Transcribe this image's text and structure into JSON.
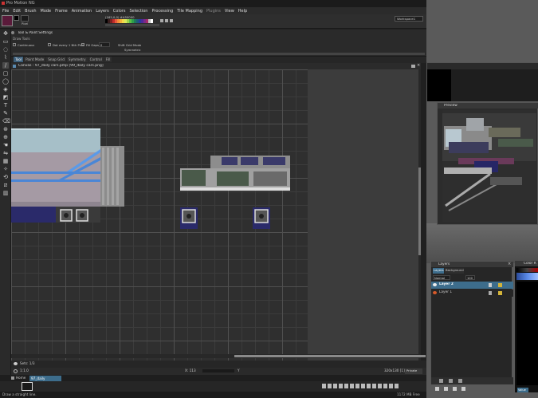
{
  "app": {
    "title": "Pro Motion NG",
    "menu": [
      "File",
      "Edit",
      "Brush",
      "Mode",
      "Frame",
      "Animation",
      "Layers",
      "Colors",
      "Selection",
      "Processing",
      "Tile Mapping",
      "Plugins",
      "View",
      "Help"
    ],
    "workspace": "Workspace1"
  },
  "toolbar": {
    "color_readout": "(165,0,0) #A50000",
    "brush_label": "Pixel",
    "brush_size": "1x1 S",
    "palette_colors": [
      "#000000",
      "#3b1f1f",
      "#7a2020",
      "#c02b2b",
      "#e85a3a",
      "#f08a3c",
      "#f4b23a",
      "#f4d648",
      "#d8e95a",
      "#9fd24a",
      "#5cbf46",
      "#2e9e4a",
      "#1e7a5a",
      "#1d5a7a",
      "#2a3a9a",
      "#4a2a9a",
      "#7a2a8a",
      "#a52a6a",
      "#c0c0c0",
      "#ffffff"
    ]
  },
  "options": {
    "title": "Tool & Paint Settings",
    "section": "Draw Tools",
    "continuous": "Continuous",
    "dot_every": "Dot every 1 Nth Pixel",
    "fill_gaps": "Fill Gaps",
    "fill_value": "0",
    "shift_grid": "Shift Grid Mode",
    "symmetric": "Symmetric"
  },
  "tabs": [
    "Tool",
    "Paint Mode",
    "Snap Grid",
    "Symmetry",
    "Control",
    "Fill"
  ],
  "canvas": {
    "title": "Canvas : 97_daily cars.pmp [99_daily cars.png]"
  },
  "layerbar": {
    "label": "Sets: 1/3"
  },
  "infobar": {
    "zoom": "1:1.0",
    "coords": "X: 113",
    "y_label": "Y",
    "size": "320x130 [1]",
    "mode": "Private"
  },
  "docbar": {
    "home": "Home",
    "doc": "97_daily cars.pmp"
  },
  "statusbar": {
    "hint": "Draw a straight line.",
    "memory": "1172 MB Free"
  },
  "preview": {
    "title": "Preview"
  },
  "layers": {
    "title": "Layers",
    "tabs": [
      "Layers",
      "Background"
    ],
    "blend": "Normal",
    "opacity": "100",
    "rows": [
      {
        "name": "Layer 2",
        "selected": true
      },
      {
        "name": "Layer 1",
        "selected": false
      }
    ]
  },
  "colorwin": {
    "title": "Color R",
    "value_label": "Value"
  },
  "colors": {
    "accent": "#3d6d8c",
    "fg_color": "#5a1a3a",
    "bg_color": "#000000"
  }
}
